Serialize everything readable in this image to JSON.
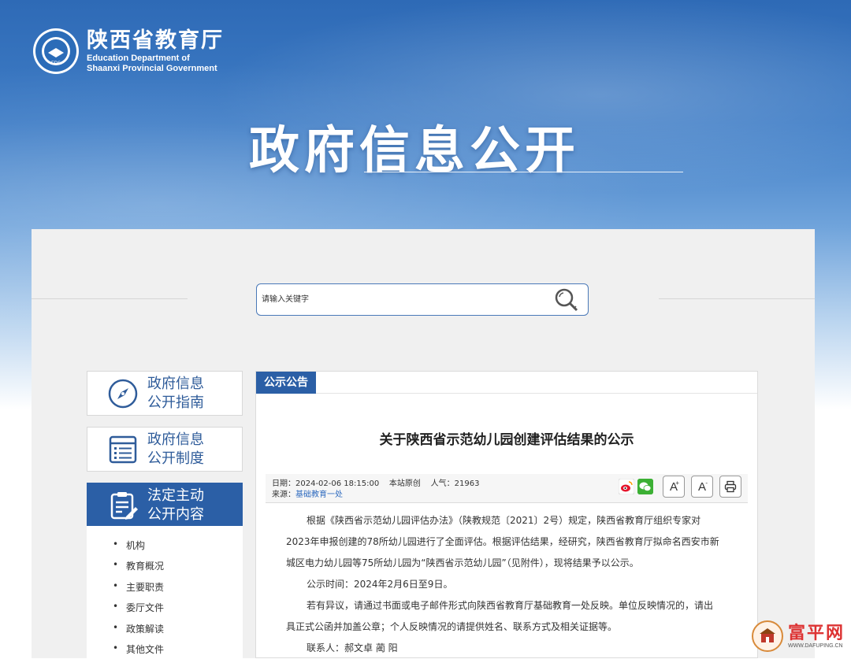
{
  "header": {
    "org_cn": "陕西省教育厅",
    "org_en_line1": "Education Department of",
    "org_en_line2": "Shaanxi Provincial Government",
    "emblem_text": "EDS",
    "banner_title": "政府信息公开"
  },
  "search": {
    "placeholder": "请输入关键字"
  },
  "sidebar": {
    "items": [
      {
        "line1": "政府信息",
        "line2": "公开指南",
        "icon": "compass-icon"
      },
      {
        "line1": "政府信息",
        "line2": "公开制度",
        "icon": "list-icon"
      },
      {
        "line1": "法定主动",
        "line2": "公开内容",
        "icon": "document-edit-icon",
        "active": true
      }
    ],
    "sub_items": [
      "机构",
      "教育概况",
      "主要职责",
      "委厅文件",
      "政策解读",
      "其他文件"
    ]
  },
  "article": {
    "section_tag": "公示公告",
    "title": "关于陕西省示范幼儿园创建评估结果的公示",
    "meta_line1": "日期：2024-02-06 18:15:00    本站原创    人气：21963",
    "meta_source_label": "来源：",
    "meta_source_link": "基础教育一处",
    "tools": {
      "font_larger": "A",
      "font_smaller": "A",
      "larger_sup": "+",
      "smaller_sup": "-"
    },
    "paragraphs": [
      "根据《陕西省示范幼儿园评估办法》（陕教规范〔2021〕2号）规定，陕西省教育厅组织专家对",
      "2023年申报创建的78所幼儿园进行了全面评估。根据评估结果，经研究，陕西省教育厅拟命名西安市新",
      "城区电力幼儿园等75所幼儿园为“陕西省示范幼儿园”（见附件），现将结果予以公示。",
      "公示时间：2024年2月6日至9日。",
      "若有异议，请通过书面或电子邮件形式向陕西省教育厅基础教育一处反映。单位反映情况的，请出",
      "具正式公函并加盖公章；个人反映情况的请提供姓名、联系方式及相关证据等。",
      "联系人：郝文卓 蔺 阳"
    ]
  },
  "watermark": {
    "text": "富平网",
    "url": "WWW.DAFUPING.CN"
  },
  "colors": {
    "brand_blue": "#2b5fa6",
    "link": "#2f6bbf"
  }
}
